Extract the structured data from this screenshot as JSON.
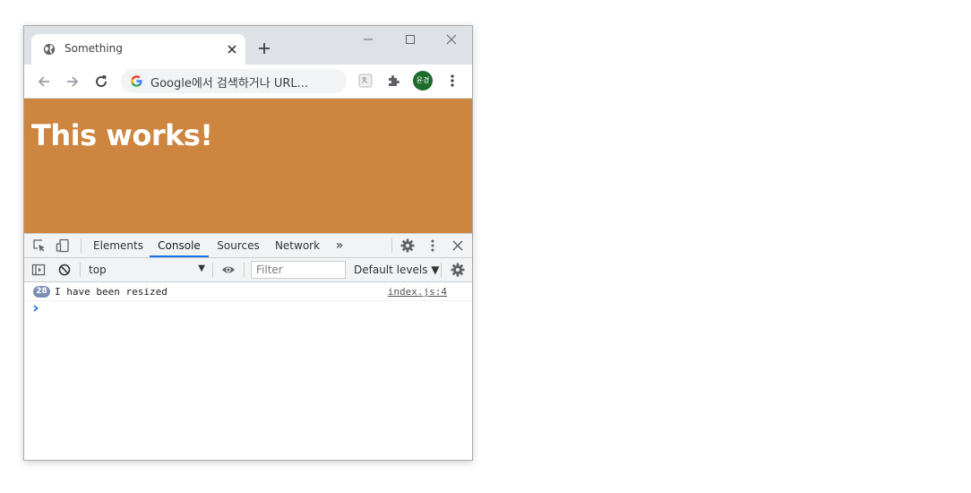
{
  "browser": {
    "tab": {
      "title": "Something",
      "icon": "globe-icon"
    },
    "new_tab_icon": "plus-icon",
    "window_controls": [
      "minimize-icon",
      "maximize-icon",
      "close-icon"
    ],
    "toolbar": {
      "back_icon": "arrow-left-icon",
      "forward_icon": "arrow-right-icon",
      "reload_icon": "reload-icon",
      "omnibox_placeholder": "Google에서 검색하거나 URL...",
      "avatar_initials": "윤경",
      "menu_icon": "kebab-menu-icon"
    }
  },
  "page": {
    "heading": "This works!",
    "background_color": "#cd853f"
  },
  "devtools": {
    "tabs": [
      {
        "label": "Elements",
        "active": false
      },
      {
        "label": "Console",
        "active": true
      },
      {
        "label": "Sources",
        "active": false
      },
      {
        "label": "Network",
        "active": false
      }
    ],
    "more_tabs": "»",
    "console": {
      "context": "top",
      "filter_placeholder": "Filter",
      "levels": "Default levels ▼",
      "messages": [
        {
          "count": "28",
          "text": "I have been resized",
          "source": "index.js:4"
        }
      ],
      "prompt": "›"
    },
    "accent_color": "#1a73e8"
  }
}
